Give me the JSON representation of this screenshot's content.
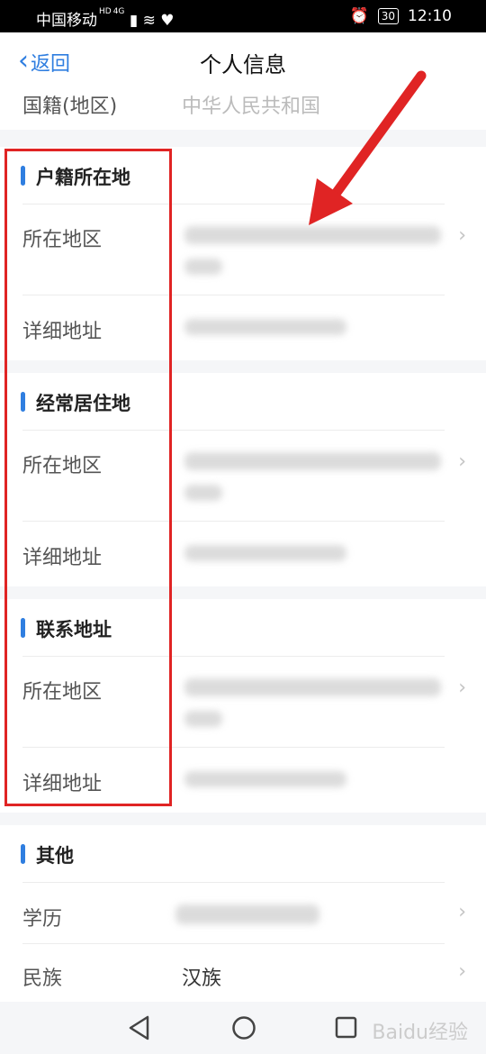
{
  "status": {
    "carrier": "中国移动",
    "net": "HD",
    "sig": "4G",
    "battery": "30",
    "time": "12:10"
  },
  "nav": {
    "back": "返回",
    "title": "个人信息"
  },
  "nationality": {
    "label": "国籍(地区)",
    "value": "中华人民共和国"
  },
  "sections": {
    "household": {
      "title": "户籍所在地",
      "region": "所在地区",
      "address": "详细地址"
    },
    "residence": {
      "title": "经常居住地",
      "region": "所在地区",
      "address": "详细地址"
    },
    "contact": {
      "title": "联系地址",
      "region": "所在地区",
      "address": "详细地址"
    },
    "other": {
      "title": "其他",
      "education": "学历",
      "ethnicity": "民族",
      "ethnicity_value": "汉族"
    }
  },
  "watermark": "Baidu经验",
  "colors": {
    "accent": "#2f7ee0",
    "highlight": "#e02424"
  },
  "icons": [
    "back-chevron-icon",
    "arrow-right-icon",
    "triangle-back-icon",
    "circle-home-icon",
    "square-recent-icon"
  ]
}
